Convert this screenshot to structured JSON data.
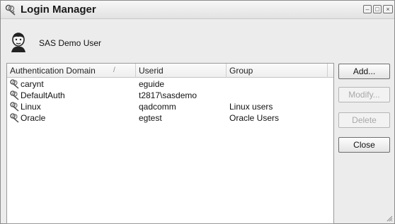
{
  "window": {
    "title": "Login Manager",
    "controls": {
      "minimize": "–",
      "maximize": "□",
      "close": "×"
    }
  },
  "user": {
    "name": "SAS Demo User",
    "icon": "person-icon"
  },
  "list": {
    "columns": [
      "Authentication Domain",
      "Userid",
      "Group"
    ],
    "sort_indicator": "/",
    "rows": [
      {
        "domain": "carynt",
        "userid": "eguide",
        "group": "",
        "icon": "keys-icon"
      },
      {
        "domain": "DefaultAuth",
        "userid": "t2817\\sasdemo",
        "group": "",
        "icon": "keys-icon"
      },
      {
        "domain": "Linux",
        "userid": "qadcomm",
        "group": "Linux users",
        "icon": "keys-icon"
      },
      {
        "domain": "Oracle",
        "userid": "egtest",
        "group": "Oracle Users",
        "icon": "keys-icon"
      }
    ]
  },
  "buttons": {
    "add": "Add...",
    "modify": "Modify...",
    "delete": "Delete",
    "close": "Close"
  }
}
